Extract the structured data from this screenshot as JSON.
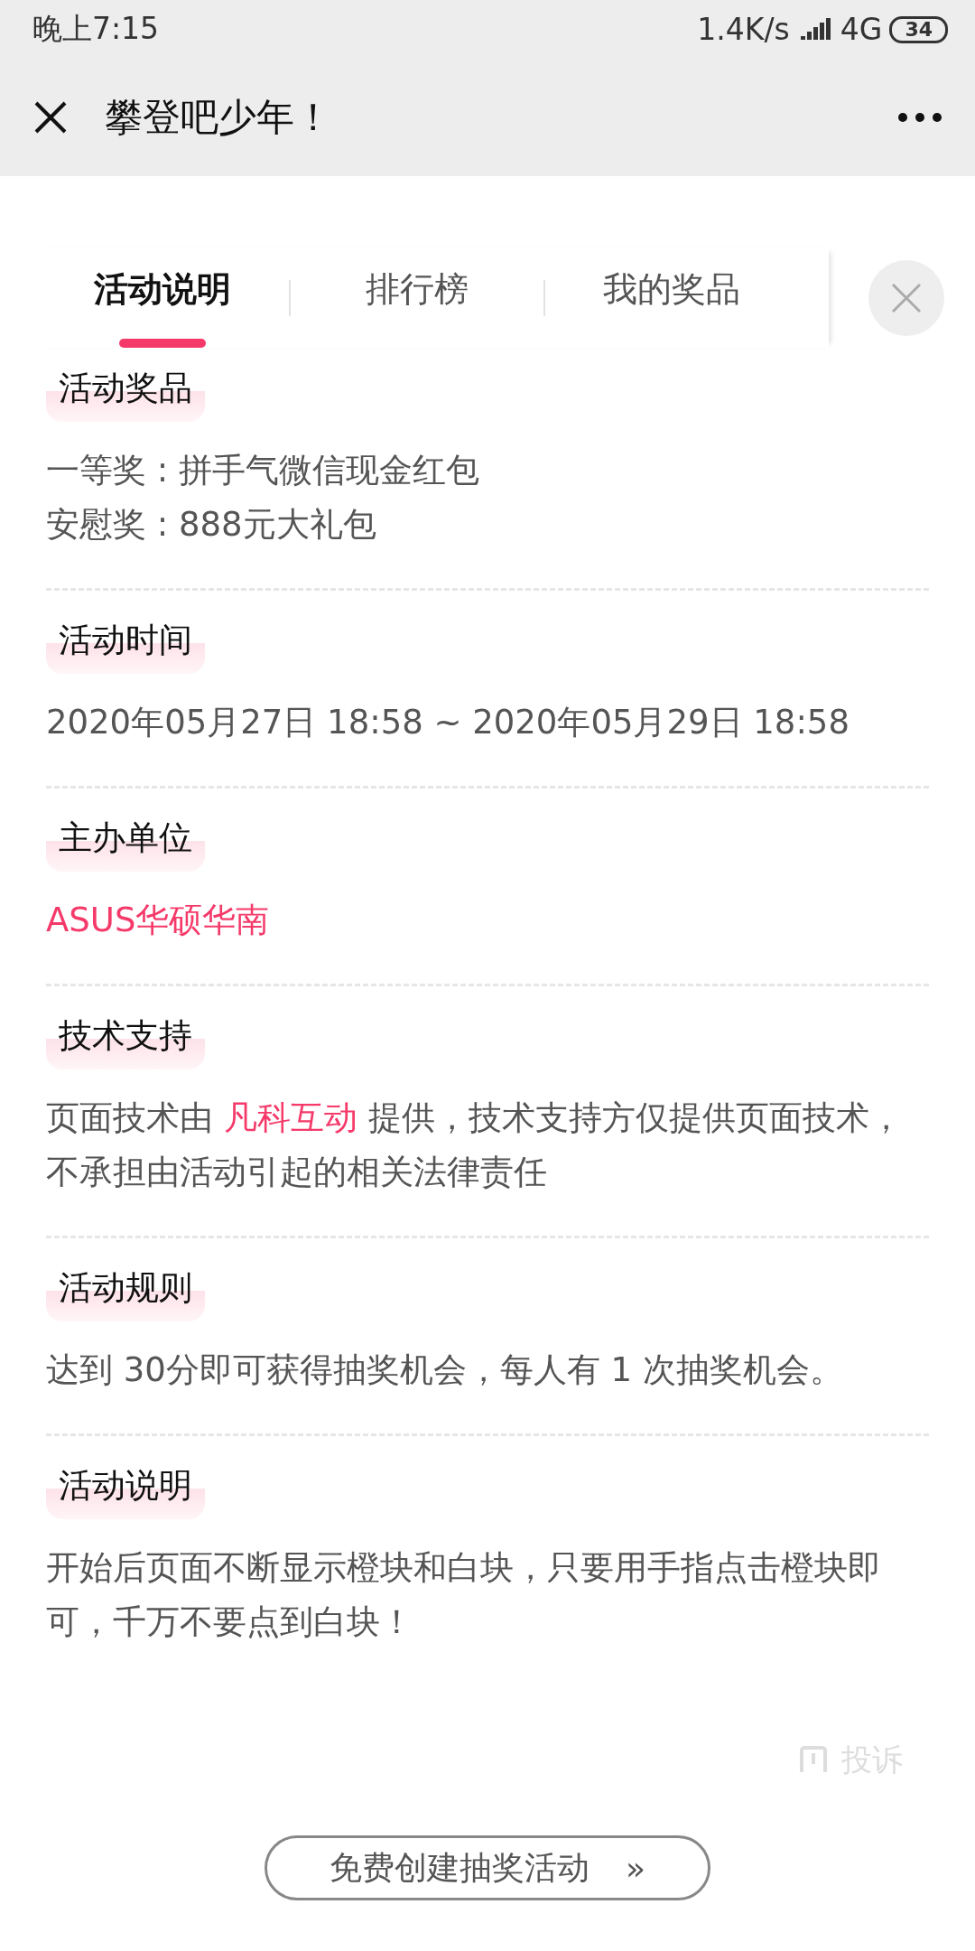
{
  "status_bar": {
    "time": "晚上7:15",
    "speed": "1.4K/s",
    "network": "4G",
    "battery": "34"
  },
  "nav": {
    "title": "攀登吧少年！"
  },
  "tabs": [
    {
      "label": "活动说明",
      "selected": true
    },
    {
      "label": "排行榜",
      "selected": false
    },
    {
      "label": "我的奖品",
      "selected": false
    }
  ],
  "sections": [
    {
      "title": "活动奖品",
      "lines": [
        [
          {
            "text": "一等奖 : 拼手气微信现金红包",
            "accent": false
          }
        ],
        [
          {
            "text": "安慰奖 : 888元大礼包",
            "accent": false
          }
        ]
      ]
    },
    {
      "title": "活动时间",
      "lines": [
        [
          {
            "text": "2020年05月27日 18:58 ~ 2020年05月29日 18:58",
            "accent": false
          }
        ]
      ]
    },
    {
      "title": "主办单位",
      "lines": [
        [
          {
            "text": "ASUS华硕华南",
            "accent": true
          }
        ]
      ]
    },
    {
      "title": "技术支持",
      "lines": [
        [
          {
            "text": "页面技术由 ",
            "accent": false
          },
          {
            "text": "凡科互动",
            "accent": true
          },
          {
            "text": " 提供，技术支持方仅提供页面技术，不承担由活动引起的相关法律责任",
            "accent": false
          }
        ]
      ]
    },
    {
      "title": "活动规则",
      "lines": [
        [
          {
            "text": "达到 30分即可获得抽奖机会，每人有 1 次抽奖机会。",
            "accent": false
          }
        ]
      ]
    },
    {
      "title": "活动说明",
      "lines": [
        [
          {
            "text": "开始后页面不断显示橙块和白块，只要用手指点击橙块即可，千万不要点到白块！",
            "accent": false
          }
        ]
      ]
    }
  ],
  "complaint": {
    "label": "投诉"
  },
  "create_button": {
    "label": "免费创建抽奖活动",
    "arrow": "»"
  }
}
